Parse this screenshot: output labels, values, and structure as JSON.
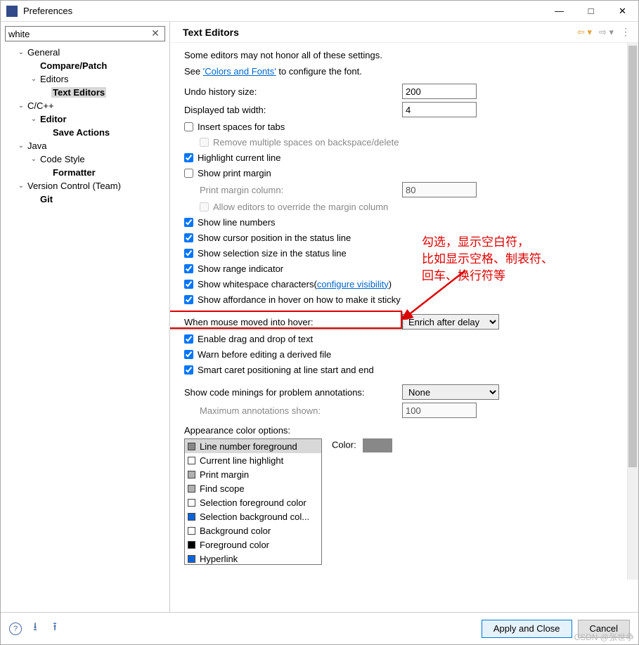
{
  "window": {
    "title": "Preferences",
    "minimize_glyph": "—",
    "maximize_glyph": "□",
    "close_glyph": "✕"
  },
  "search": {
    "value": "white",
    "clear_glyph": "✕"
  },
  "tree": [
    {
      "label": "General",
      "level": 1,
      "expandable": true,
      "expanded": true
    },
    {
      "label": "Compare/Patch",
      "level": 2,
      "bold": true
    },
    {
      "label": "Editors",
      "level": 2,
      "expandable": true,
      "expanded": true
    },
    {
      "label": "Text Editors",
      "level": 3,
      "bold": true,
      "selected": true
    },
    {
      "label": "C/C++",
      "level": 1,
      "expandable": true,
      "expanded": true
    },
    {
      "label": "Editor",
      "level": 2,
      "bold": true,
      "expandable": true,
      "expanded": true
    },
    {
      "label": "Save Actions",
      "level": 3,
      "bold": true
    },
    {
      "label": "Java",
      "level": 1,
      "expandable": true,
      "expanded": true
    },
    {
      "label": "Code Style",
      "level": 2,
      "expandable": true,
      "expanded": true
    },
    {
      "label": "Formatter",
      "level": 3,
      "bold": true
    },
    {
      "label": "Version Control (Team)",
      "level": 1,
      "expandable": true,
      "expanded": true
    },
    {
      "label": "Git",
      "level": 2,
      "bold": true
    }
  ],
  "page": {
    "title": "Text Editors",
    "intro": "Some editors may not honor all of these settings.",
    "see_prefix": "See ",
    "see_link": "'Colors and Fonts'",
    "see_suffix": " to configure the font.",
    "undo_label": "Undo history size:",
    "undo_value": "200",
    "tabwidth_label": "Displayed tab width:",
    "tabwidth_value": "4",
    "insert_spaces": "Insert spaces for tabs",
    "remove_multiple": "Remove multiple spaces on backspace/delete",
    "highlight_current": "Highlight current line",
    "show_print_margin": "Show print margin",
    "print_margin_col": "Print margin column:",
    "print_margin_val": "80",
    "allow_override": "Allow editors to override the margin column",
    "show_line_numbers": "Show line numbers",
    "show_cursor_pos": "Show cursor position in the status line",
    "show_sel_size": "Show selection size in the status line",
    "show_range": "Show range indicator",
    "show_whitespace": "Show whitespace characters ",
    "configure_vis": "configure visibility",
    "show_affordance": "Show affordance in hover on how to make it sticky",
    "mouse_hover_label": "When mouse moved into hover:",
    "mouse_hover_value": "Enrich after delay",
    "enable_dnd": "Enable drag and drop of text",
    "warn_derived": "Warn before editing a derived file",
    "smart_caret": "Smart caret positioning at line start and end",
    "minings_label": "Show code minings for problem annotations:",
    "minings_value": "None",
    "max_annot_label": "Maximum annotations shown:",
    "max_annot_value": "100",
    "appearance_label": "Appearance color options:",
    "color_label": "Color:"
  },
  "color_options": [
    {
      "name": "Line number foreground",
      "color": "#888888",
      "selected": true
    },
    {
      "name": "Current line highlight",
      "color": "#ffffff"
    },
    {
      "name": "Print margin",
      "color": "#b0b0b0"
    },
    {
      "name": "Find scope",
      "color": "#b0b0b0"
    },
    {
      "name": "Selection foreground color",
      "color": "#ffffff"
    },
    {
      "name": "Selection background col...",
      "color": "#0a64d8"
    },
    {
      "name": "Background color",
      "color": "#ffffff"
    },
    {
      "name": "Foreground color",
      "color": "#000000"
    },
    {
      "name": "Hyperlink",
      "color": "#0a64d8"
    }
  ],
  "annotation": {
    "text": "勾选，显示空白符，\n比如显示空格、制表符、\n回车、换行符等"
  },
  "footer": {
    "apply": "Apply and Close",
    "cancel": "Cancel"
  },
  "watermark": "CSDN @张世争"
}
